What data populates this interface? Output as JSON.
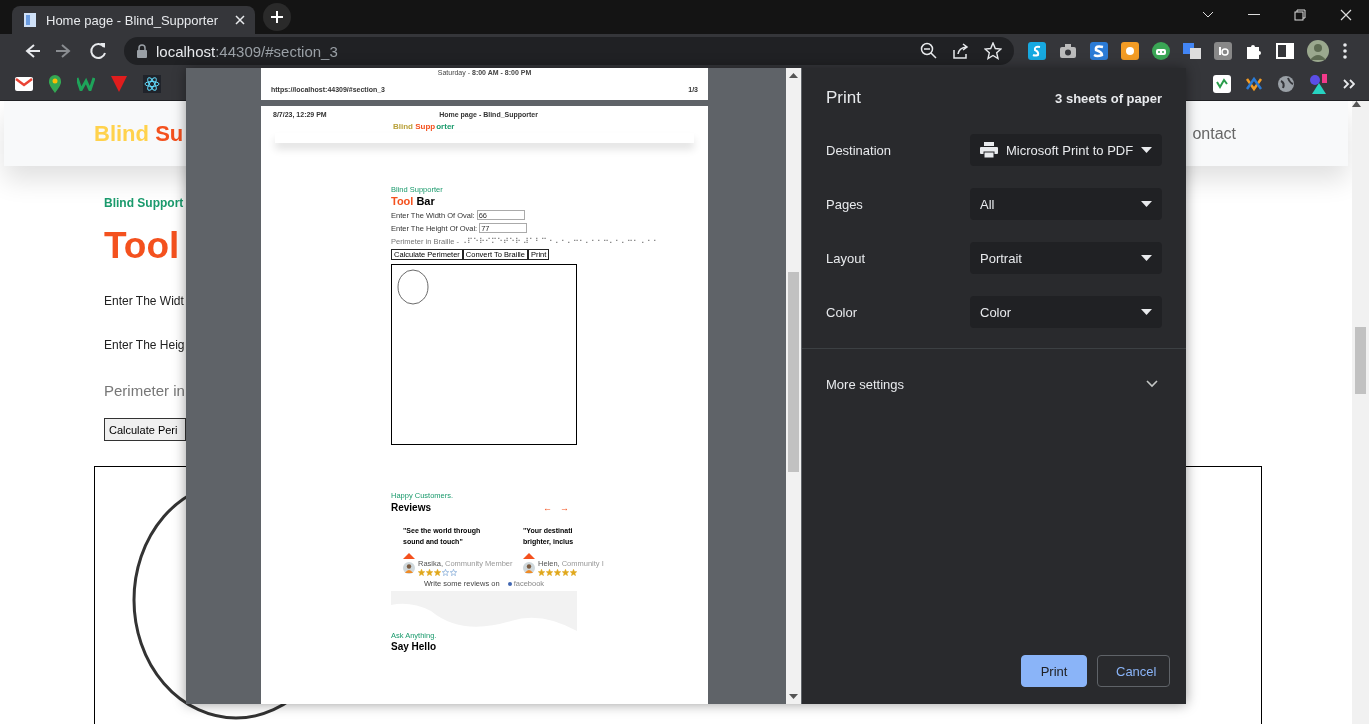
{
  "browser": {
    "tab": {
      "title": "Home page - Blind_Supporter"
    },
    "nav_buttons": [
      {
        "kind": "back",
        "disabled": false
      },
      {
        "kind": "forward",
        "disabled": true
      },
      {
        "kind": "reload",
        "disabled": false
      }
    ],
    "address": {
      "host": "localhost",
      "rest": ":44309/#section_3"
    }
  },
  "page": {
    "logo_first": "Blind",
    "logo_second": "Su",
    "nav_link": "ontact",
    "eyebrow": "Blind Support",
    "heading": "Tool",
    "width_label": "Enter The Widt",
    "height_label": "Enter The Heig",
    "perimeter_label": "Perimeter in",
    "calculate_button": "Calculate Peri"
  },
  "print_preview": {
    "previous_page": {
      "hours": "Saturday - **8:00 AM - 8:00 PM**",
      "url": "https://localhost:44309/#section_3",
      "page_number": "1/3"
    },
    "page": {
      "date": "8/7/23, 12:29 PM",
      "title": "Home page - Blind_Supporter",
      "logo_first": "Blind",
      "logo_middle": "Supp",
      "logo_last": "orter",
      "eyebrow": "Blind Supporter",
      "heading_accent": "Tool",
      "heading": "Bar",
      "fields": [
        {
          "label": "Enter The Width Of Oval:",
          "value": "66"
        },
        {
          "label": "Enter The Height Of Oval:",
          "value": "77"
        }
      ],
      "perimeter": "Perimeter in Braille - ⠠⠏⠑⠗⠊⠍⠑⠞⠑⠗ ⠼⠁⠃⠉ ⠂⠄⠂⠄⠒⠂⠄⠂⠂⠒⠄⠂⠄⠒⠂ ⠄⠂⠂",
      "buttons": [
        "Calculate Perimeter",
        "Convert To Braille",
        "Print"
      ],
      "reviews_eyebrow": "Happy Customers.",
      "reviews_heading": "Reviews",
      "prev_arrow": "←",
      "next_arrow": "→",
      "reviews": [
        {
          "quote_lines": [
            "\"See the world through",
            "sound and touch\""
          ],
          "name": "Rasika,",
          "role": "Community Member",
          "stars": 3
        },
        {
          "quote_lines": [
            "\"Your destinati",
            "brighter, inclus"
          ],
          "name": "Helen,",
          "role": "Community I",
          "stars": 5
        }
      ],
      "review_prompt": "Write some reviews on",
      "review_site": "facebook",
      "contact_eyebrow": "Ask Anything.",
      "contact_heading": "Say Hello"
    }
  },
  "print_panel": {
    "title": "Print",
    "sheets": "3 sheets of paper",
    "settings": [
      {
        "label": "Destination",
        "value": "Microsoft Print to PDF",
        "kind": "printer"
      },
      {
        "label": "Pages",
        "value": "All",
        "kind": "plain"
      },
      {
        "label": "Layout",
        "value": "Portrait",
        "kind": "plain"
      },
      {
        "label": "Color",
        "value": "Color",
        "kind": "plain"
      }
    ],
    "more_settings": {
      "label": "More settings",
      "expanded": false
    },
    "buttons": [
      {
        "label": "Print",
        "kind": "primary"
      },
      {
        "label": "Cancel",
        "kind": "secondary"
      }
    ]
  }
}
